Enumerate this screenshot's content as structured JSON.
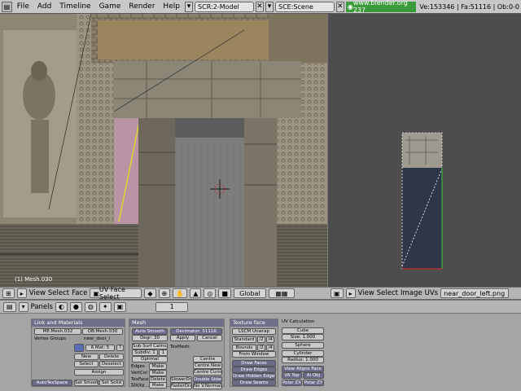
{
  "topbar": {
    "menus": [
      "File",
      "Add",
      "Timeline",
      "Game",
      "Render",
      "Help"
    ],
    "screen": "SCR:2-Model",
    "scene": "SCE:Scene",
    "url": "www.blender.org 237",
    "stats": "Ve:153346 | Fa:51116 | Ob:0-0"
  },
  "view3d": {
    "object_label": "(1) Mesh.030"
  },
  "header3d": {
    "view": "View",
    "select": "Select",
    "face": "Face",
    "mode": "UV Face Select",
    "orientation": "Global"
  },
  "headerUV": {
    "view": "View",
    "select": "Select",
    "image": "Image",
    "uvs": "UVs",
    "image_name": "near_door_left.png"
  },
  "buttons": {
    "panels_label": "Panels",
    "frame": "1",
    "link": {
      "title": "Link and Materials",
      "me": "ME:Mesh.032",
      "ob": "OB:Mesh.030",
      "vgroups": "Vertex Groups",
      "mat_name": "near_door_l",
      "mat_count": "6 Mat: 5",
      "new": "New",
      "delete": "Delete",
      "select": "Select",
      "deselect": "Deselect",
      "assign": "Assign",
      "autotex": "AutoTexSpace",
      "setsmooth": "Set Smooth",
      "setsolid": "Set Solid"
    },
    "mesh": {
      "title": "Mesh",
      "autosmooth": "Auto Smooth",
      "degr": "Degr: 30",
      "subsurf": "Sub Surf Catmull",
      "subdiv": "Subdiv: 1",
      "subdiv2": "1",
      "optimal": "Optimal",
      "edges": "Edges",
      "vertcol": "VertCol",
      "texface": "TexFace",
      "sticky": "Sticky",
      "make": "Make",
      "delete": "Delete",
      "decimator": "Decimator: 51116",
      "apply": "Apply",
      "cancel": "Cancel",
      "texmesh": "TexMesh:",
      "centre": "Centre",
      "centrenew": "Centre New",
      "centrecursor": "Centre Cursor",
      "slowerdraw": "SlowerDraw",
      "fasterdraw": "FasterDraw",
      "doublesided": "Double Sided",
      "nonormal": "No V.Normal Flip"
    },
    "texface": {
      "title": "Texture face",
      "lscm": "LSCM Unwrap",
      "standard": "Standard",
      "bounds": "Bounds",
      "fromwindow": "From Window",
      "drawfaces": "Draw Faces",
      "drawedges": "Draw Edges",
      "drawhidden": "Draw Hidden Edges",
      "drawseams": "Draw Seams"
    },
    "uvcalc": {
      "title": "UV Calculation",
      "cube": "Cube",
      "size": "Size: 1.000",
      "sphere": "Sphere",
      "cylinder": "Cylinder",
      "radius": "Radius: 1.000",
      "viewaligns": "View Aligns Face",
      "vatop": "VA Top",
      "alobj": "Al Obj",
      "polarzx": "Polar ZX",
      "polarzy": "Polar ZY"
    }
  },
  "colors": {
    "uvbg": "#4d4d4d",
    "accent": "#6f6f8a"
  }
}
